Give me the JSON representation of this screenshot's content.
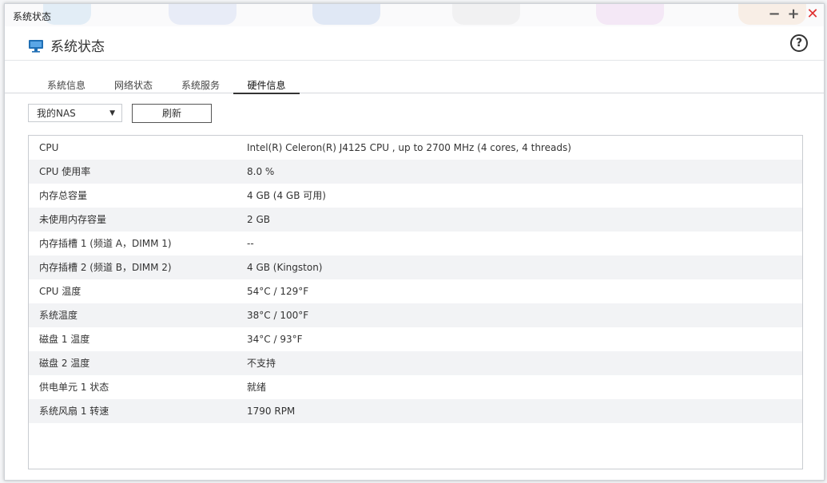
{
  "window": {
    "title": "系统状态",
    "app_title": "系统状态"
  },
  "tabs": [
    {
      "label": "系統信息",
      "active": false
    },
    {
      "label": "网络状态",
      "active": false
    },
    {
      "label": "系统服务",
      "active": false
    },
    {
      "label": "硬件信息",
      "active": true
    }
  ],
  "toolbar": {
    "device_select_value": "我的NAS",
    "refresh_label": "刷新"
  },
  "hardware": {
    "rows": [
      {
        "label": "CPU",
        "value": "Intel(R) Celeron(R) J4125 CPU , up to 2700 MHz (4 cores, 4 threads)"
      },
      {
        "label": "CPU 使用率",
        "value": "8.0 %"
      },
      {
        "label": "内存总容量",
        "value": "4 GB (4 GB 可用)"
      },
      {
        "label": "未使用内存容量",
        "value": "2 GB"
      },
      {
        "label": "内存插槽 1 (频道 A，DIMM 1)",
        "value": "--"
      },
      {
        "label": "内存插槽 2 (频道 B，DIMM 2)",
        "value": "4 GB (Kingston)"
      },
      {
        "label": "CPU 温度",
        "value": "54°C / 129°F"
      },
      {
        "label": "系统温度",
        "value": "38°C / 100°F"
      },
      {
        "label": "磁盘 1 温度",
        "value": "34°C / 93°F"
      },
      {
        "label": "磁盘 2 温度",
        "value": "不支持"
      },
      {
        "label": "供电单元 1 状态",
        "value": "就绪"
      },
      {
        "label": "系统风扇 1 转速",
        "value": "1790 RPM"
      }
    ]
  },
  "colors": {
    "accent": "#1f6fb5",
    "close": "#e03131"
  }
}
